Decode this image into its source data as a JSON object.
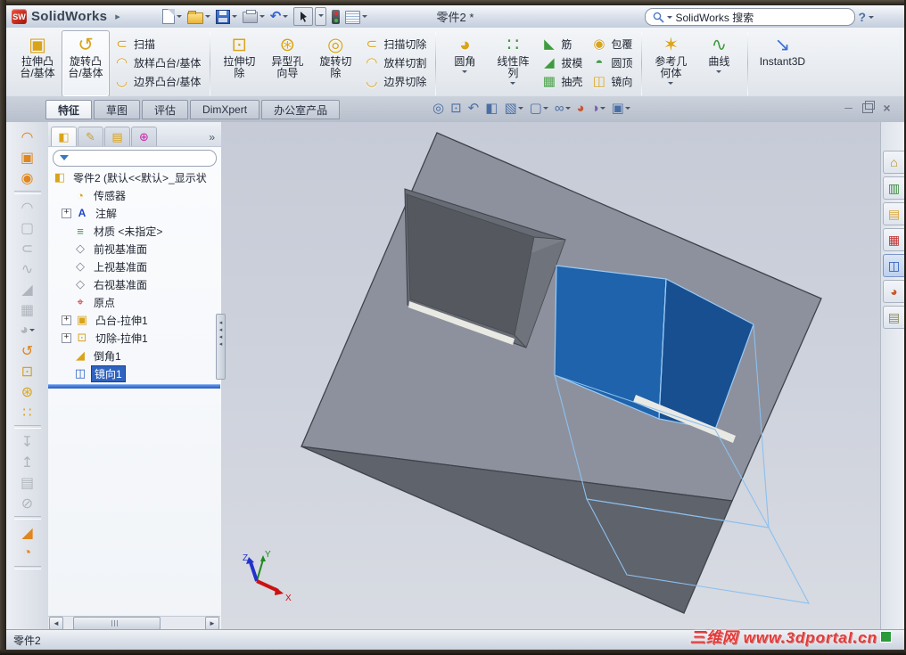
{
  "window": {
    "app_name": "SolidWorks",
    "logo_text": "SW",
    "document_title": "零件2 *",
    "help_label": "?"
  },
  "search": {
    "text": "SolidWorks 搜索"
  },
  "titlebar_icons": [
    "new-icon",
    "open-icon",
    "save-icon",
    "print-icon",
    "undo-icon",
    "select-cursor-icon",
    "rebuild-traffic-light-icon",
    "options-icon"
  ],
  "ribbon": {
    "g1": {
      "big": [
        {
          "name": "extruded-boss-base-button",
          "label": "拉伸凸\n台/基体",
          "glyph": "▣"
        },
        {
          "name": "revolved-boss-base-button",
          "label": "旋转凸\n台/基体",
          "glyph": "↺",
          "hover": true
        }
      ],
      "stack": [
        {
          "name": "swept-boss-base-button",
          "label": "扫描",
          "glyph": "⊂"
        },
        {
          "name": "lofted-boss-base-button",
          "label": "放样凸台/基体",
          "glyph": "◠"
        },
        {
          "name": "boundary-boss-base-button",
          "label": "边界凸台/基体",
          "glyph": "◡"
        }
      ]
    },
    "g2": {
      "big": [
        {
          "name": "extruded-cut-button",
          "label": "拉伸切\n除",
          "glyph": "⊡"
        },
        {
          "name": "hole-wizard-button",
          "label": "异型孔\n向导",
          "glyph": "⊛"
        },
        {
          "name": "revolved-cut-button",
          "label": "旋转切\n除",
          "glyph": "◎"
        }
      ],
      "stack": [
        {
          "name": "swept-cut-button",
          "label": "扫描切除",
          "glyph": "⊂"
        },
        {
          "name": "lofted-cut-button",
          "label": "放样切割",
          "glyph": "◠"
        },
        {
          "name": "boundary-cut-button",
          "label": "边界切除",
          "glyph": "◡"
        }
      ]
    },
    "g3": {
      "big": [
        {
          "name": "fillet-button",
          "label": "圆角",
          "glyph": "◕",
          "dd": true
        },
        {
          "name": "linear-pattern-button",
          "label": "线性阵\n列",
          "glyph": "∷",
          "dd": true
        }
      ],
      "stackA": [
        {
          "name": "rib-button",
          "label": "筋",
          "glyph": "◣"
        },
        {
          "name": "draft-button",
          "label": "拔模",
          "glyph": "◢"
        },
        {
          "name": "shell-button",
          "label": "抽壳",
          "glyph": "▦"
        }
      ],
      "stackB": [
        {
          "name": "wrap-button",
          "label": "包覆",
          "glyph": "◉"
        },
        {
          "name": "dome-button",
          "label": "圆顶",
          "glyph": "◓"
        },
        {
          "name": "mirror-button",
          "label": "镜向",
          "glyph": "◫"
        }
      ]
    },
    "g4": {
      "big": [
        {
          "name": "reference-geometry-button",
          "label": "参考几\n何体",
          "glyph": "✶",
          "dd": true
        },
        {
          "name": "curves-button",
          "label": "曲线",
          "glyph": "∿",
          "dd": true
        }
      ]
    },
    "g5": {
      "big": [
        {
          "name": "instant3d-button",
          "label": "Instant3D",
          "glyph": "↘"
        }
      ]
    }
  },
  "tabs": [
    {
      "name": "tab-features",
      "label": "特征",
      "active": true
    },
    {
      "name": "tab-sketch",
      "label": "草图"
    },
    {
      "name": "tab-evaluate",
      "label": "评估"
    },
    {
      "name": "tab-dimxpert",
      "label": "DimXpert"
    },
    {
      "name": "tab-office-products",
      "label": "办公室产品"
    }
  ],
  "hud": [
    {
      "name": "zoom-fit-icon",
      "glyph": "◎"
    },
    {
      "name": "zoom-area-icon",
      "glyph": "⊡"
    },
    {
      "name": "previous-view-icon",
      "glyph": "↶"
    },
    {
      "name": "section-view-icon",
      "glyph": "◧"
    },
    {
      "name": "view-orientation-icon",
      "glyph": "▧",
      "dd": true
    },
    {
      "name": "display-style-icon",
      "glyph": "▢",
      "dd": true
    },
    {
      "name": "hide-show-items-icon",
      "glyph": "∞",
      "dd": true
    },
    {
      "name": "edit-appearance-icon",
      "glyph": "◕",
      "color": "#cc5533"
    },
    {
      "name": "apply-scene-icon",
      "glyph": "◑",
      "dd": true,
      "color": "#7a5fb0"
    },
    {
      "name": "view-settings-icon",
      "glyph": "▣",
      "dd": true
    }
  ],
  "left_toolbar": [
    {
      "name": "swept-surface-icon",
      "glyph": "◠",
      "color": "#e0861c"
    },
    {
      "name": "extruded-surface-icon",
      "glyph": "▣",
      "color": "#e0861c"
    },
    {
      "name": "revolved-surface-icon",
      "glyph": "◉",
      "color": "#e0861c"
    },
    {
      "sep": true
    },
    {
      "name": "lofted-surface-icon",
      "glyph": "◠",
      "disabled": true
    },
    {
      "name": "boundary-surface-icon",
      "glyph": "▢",
      "disabled": true
    },
    {
      "name": "sweep-icon",
      "glyph": "⊂",
      "disabled": true
    },
    {
      "name": "curve-icon",
      "glyph": "∿",
      "disabled": true
    },
    {
      "name": "draft-icon",
      "glyph": "◢",
      "disabled": true
    },
    {
      "name": "shell-icon",
      "glyph": "▦",
      "disabled": true
    },
    {
      "name": "fillet-icon",
      "glyph": "◕",
      "disabled": true,
      "dd": true
    },
    {
      "name": "revolve-icon",
      "glyph": "↺",
      "color": "#e0861c"
    },
    {
      "name": "extruded-cut-icon",
      "glyph": "⊡",
      "color": "#d9a41b"
    },
    {
      "name": "hole-wizard-icon",
      "glyph": "⊛",
      "color": "#d9a41b"
    },
    {
      "name": "pattern-icon",
      "glyph": "∷",
      "color": "#d9a41b"
    },
    {
      "sep": true
    },
    {
      "name": "move-body-icon",
      "glyph": "↧",
      "disabled": true
    },
    {
      "name": "rotate-body-icon",
      "glyph": "↥",
      "disabled": true
    },
    {
      "name": "combine-icon",
      "glyph": "▤",
      "disabled": true
    },
    {
      "name": "intersect-icon",
      "glyph": "⊘",
      "disabled": true
    },
    {
      "sep": true
    },
    {
      "name": "chamfer-icon",
      "glyph": "◢",
      "color": "#e0861c"
    },
    {
      "name": "wrap-icon",
      "glyph": "◔",
      "color": "#e0861c"
    },
    {
      "sep": true
    }
  ],
  "panel": {
    "tabs": [
      {
        "name": "featuremanager-tab-icon",
        "glyph": "◧",
        "color": "#d9a41b",
        "active": true
      },
      {
        "name": "propertymanager-tab-icon",
        "glyph": "✎",
        "color": "#caa02a"
      },
      {
        "name": "configurationmanager-tab-icon",
        "glyph": "▤",
        "color": "#d9a41b"
      },
      {
        "name": "dimxpertmanager-tab-icon",
        "glyph": "⊕",
        "color": "#cc22aa"
      }
    ],
    "chevron": "»",
    "splitter_arrows": "◂\n◂\n◂\n◂",
    "scroll_left": "◄",
    "scroll_right": "►"
  },
  "tree": {
    "root": {
      "name": "tree-item-part",
      "icon": "part-icon",
      "glyph": "◧",
      "color": "#d9a41b",
      "label": "零件2 (默认<<默认>_显示状"
    },
    "items": [
      {
        "name": "tree-item-sensors",
        "icon": "sensors-icon",
        "glyph": "◔",
        "color": "#d9a41b",
        "label": "传感器"
      },
      {
        "name": "tree-item-annotations",
        "icon": "annotations-icon",
        "glyph": "A",
        "color": "#1a46c8",
        "label": "注解",
        "expand": true
      },
      {
        "name": "tree-item-material",
        "icon": "material-icon",
        "glyph": "≡",
        "color": "#3f9b3f",
        "label": "材质 <未指定>"
      },
      {
        "name": "tree-item-front-plane",
        "icon": "plane-icon",
        "glyph": "◇",
        "color": "#7d828c",
        "label": "前视基准面"
      },
      {
        "name": "tree-item-top-plane",
        "icon": "plane-icon",
        "glyph": "◇",
        "color": "#7d828c",
        "label": "上视基准面"
      },
      {
        "name": "tree-item-right-plane",
        "icon": "plane-icon",
        "glyph": "◇",
        "color": "#7d828c",
        "label": "右视基准面"
      },
      {
        "name": "tree-item-origin",
        "icon": "origin-icon",
        "glyph": "⌖",
        "color": "#cc2222",
        "label": "原点"
      },
      {
        "name": "tree-item-boss-extrude1",
        "icon": "boss-extrude-icon",
        "glyph": "▣",
        "color": "#d9a41b",
        "label": "凸台-拉伸1",
        "expand": true
      },
      {
        "name": "tree-item-cut-extrude1",
        "icon": "cut-extrude-icon",
        "glyph": "⊡",
        "color": "#d9a41b",
        "label": "切除-拉伸1",
        "expand": true
      },
      {
        "name": "tree-item-chamfer1",
        "icon": "chamfer-icon",
        "glyph": "◢",
        "color": "#d9a41b",
        "label": "倒角1"
      },
      {
        "name": "tree-item-mirror1",
        "icon": "mirror-icon",
        "glyph": "◫",
        "color": "#2a62c0",
        "label": "镜向1",
        "selected": true
      }
    ]
  },
  "right_panel": [
    {
      "name": "solidworks-resources-icon",
      "glyph": "⌂",
      "color": "#b8860b"
    },
    {
      "name": "design-library-icon",
      "glyph": "▥",
      "color": "#3a8a3a"
    },
    {
      "name": "file-explorer-icon",
      "glyph": "▤",
      "color": "#d8a83a"
    },
    {
      "name": "toolbox-icon",
      "glyph": "▦",
      "color": "#c03030"
    },
    {
      "name": "view-palette-icon",
      "glyph": "◫",
      "color": "#2255bb",
      "active": true
    },
    {
      "name": "appearances-icon",
      "glyph": "◕",
      "color": "#cc5522"
    },
    {
      "name": "custom-properties-icon",
      "glyph": "▤",
      "color": "#8a8a55"
    }
  ],
  "viewport": {
    "triad": {
      "x": "X",
      "y": "Y",
      "z": "Z"
    }
  },
  "statusbar": {
    "text": "零件2"
  },
  "watermark": {
    "text": "三维网 www.3dportal.cn"
  },
  "colors": {
    "selection_blue": "#2f63c0",
    "preview_face": "#1e63ab",
    "preview_face_dark": "#174f90",
    "wireframe_blue": "#8cc0ee",
    "part_top_face": "#8d919d",
    "part_front_face": "#5f636c"
  }
}
